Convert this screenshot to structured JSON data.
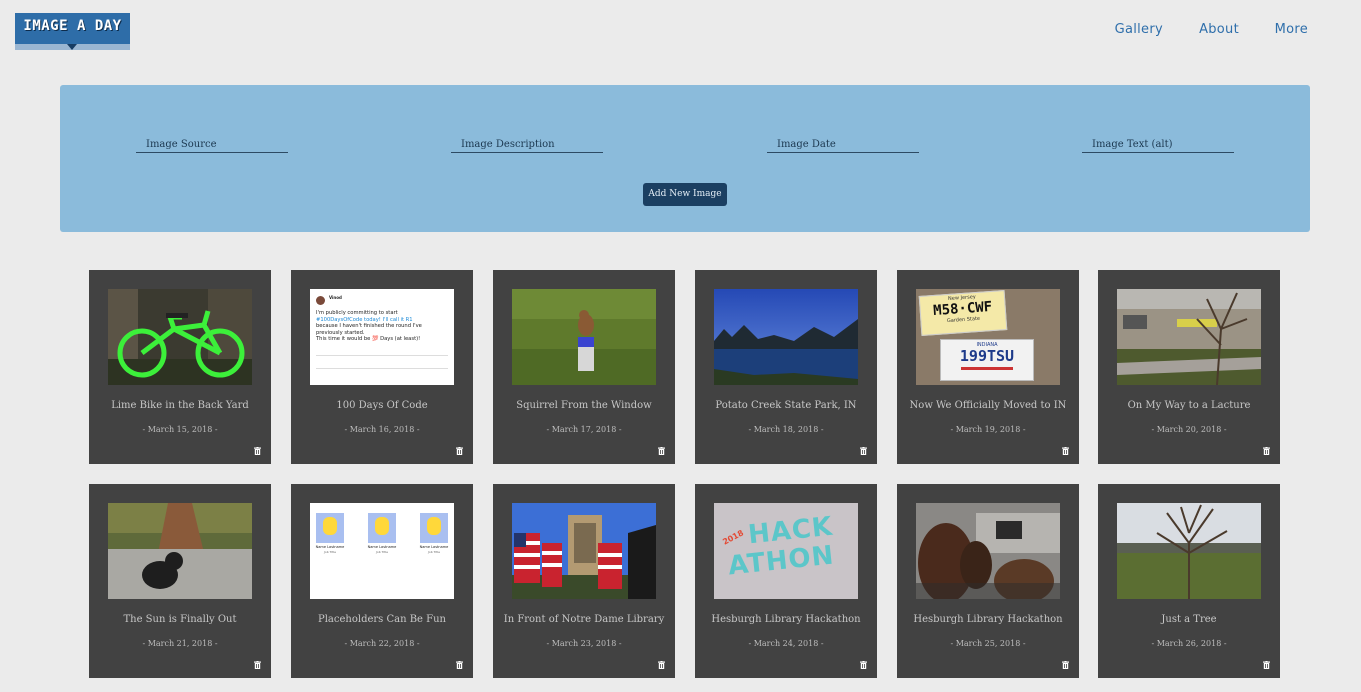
{
  "header": {
    "logo_text": "IMAGE A DAY",
    "nav": [
      {
        "label": "Gallery"
      },
      {
        "label": "About"
      },
      {
        "label": "More"
      }
    ]
  },
  "form": {
    "fields": [
      {
        "placeholder": "Image Source",
        "value": ""
      },
      {
        "placeholder": "Image Description",
        "value": ""
      },
      {
        "placeholder": "Image Date",
        "value": ""
      },
      {
        "placeholder": "Image Text (alt)",
        "value": ""
      }
    ],
    "submit_label": "Add New Image"
  },
  "gallery": [
    {
      "caption": "Lime Bike in the Back Yard",
      "date": "- March 15, 2018 -"
    },
    {
      "caption": "100 Days Of Code",
      "date": "- March 16, 2018 -",
      "tweet": {
        "user": "Vinod",
        "lines": [
          "I'm publicly committing to start",
          "#100DaysOfCode today! I'll call it R1",
          "because I haven't finished the round I've",
          "previously started.",
          "This time it would be 💯 Days (at least)!"
        ]
      }
    },
    {
      "caption": "Squirrel From the Window",
      "date": "- March 17, 2018 -"
    },
    {
      "caption": "Potato Creek State Park, IN",
      "date": "- March 18, 2018 -"
    },
    {
      "caption": "Now We Officially Moved to IN",
      "date": "- March 19, 2018 -",
      "plates": {
        "top": "M58·CWF",
        "top_state": "New Jersey",
        "top_sub": "Garden State",
        "bottom": "199TSU",
        "bottom_state": "INDIANA"
      }
    },
    {
      "caption": "On My Way to a Lacture",
      "date": "- March 20, 2018 -"
    },
    {
      "caption": "The Sun is Finally Out",
      "date": "- March 21, 2018 -"
    },
    {
      "caption": "Placeholders Can Be Fun",
      "date": "- March 22, 2018 -",
      "placeholder_label": "Name Lastname",
      "placeholder_sub": "Job Title"
    },
    {
      "caption": "In Front of Notre Dame Library",
      "date": "- March 23, 2018 -"
    },
    {
      "caption": "Hesburgh Library Hackathon",
      "date": "- March 24, 2018 -",
      "hack": {
        "year": "2018",
        "line1": "HACK",
        "line2": "ATHON"
      }
    },
    {
      "caption": "Hesburgh Library Hackathon",
      "date": "- March 25, 2018 -"
    },
    {
      "caption": "Just a Tree",
      "date": "- March 26, 2018 -"
    }
  ],
  "icons": {
    "delete": "trash-icon"
  },
  "colors": {
    "page_bg": "#ebebeb",
    "panel_bg": "#8bbbdb",
    "card_bg": "#424242",
    "nav_link": "#2f6fab",
    "button_bg": "#1b3f62",
    "logo_bg": "#2e6da8"
  }
}
